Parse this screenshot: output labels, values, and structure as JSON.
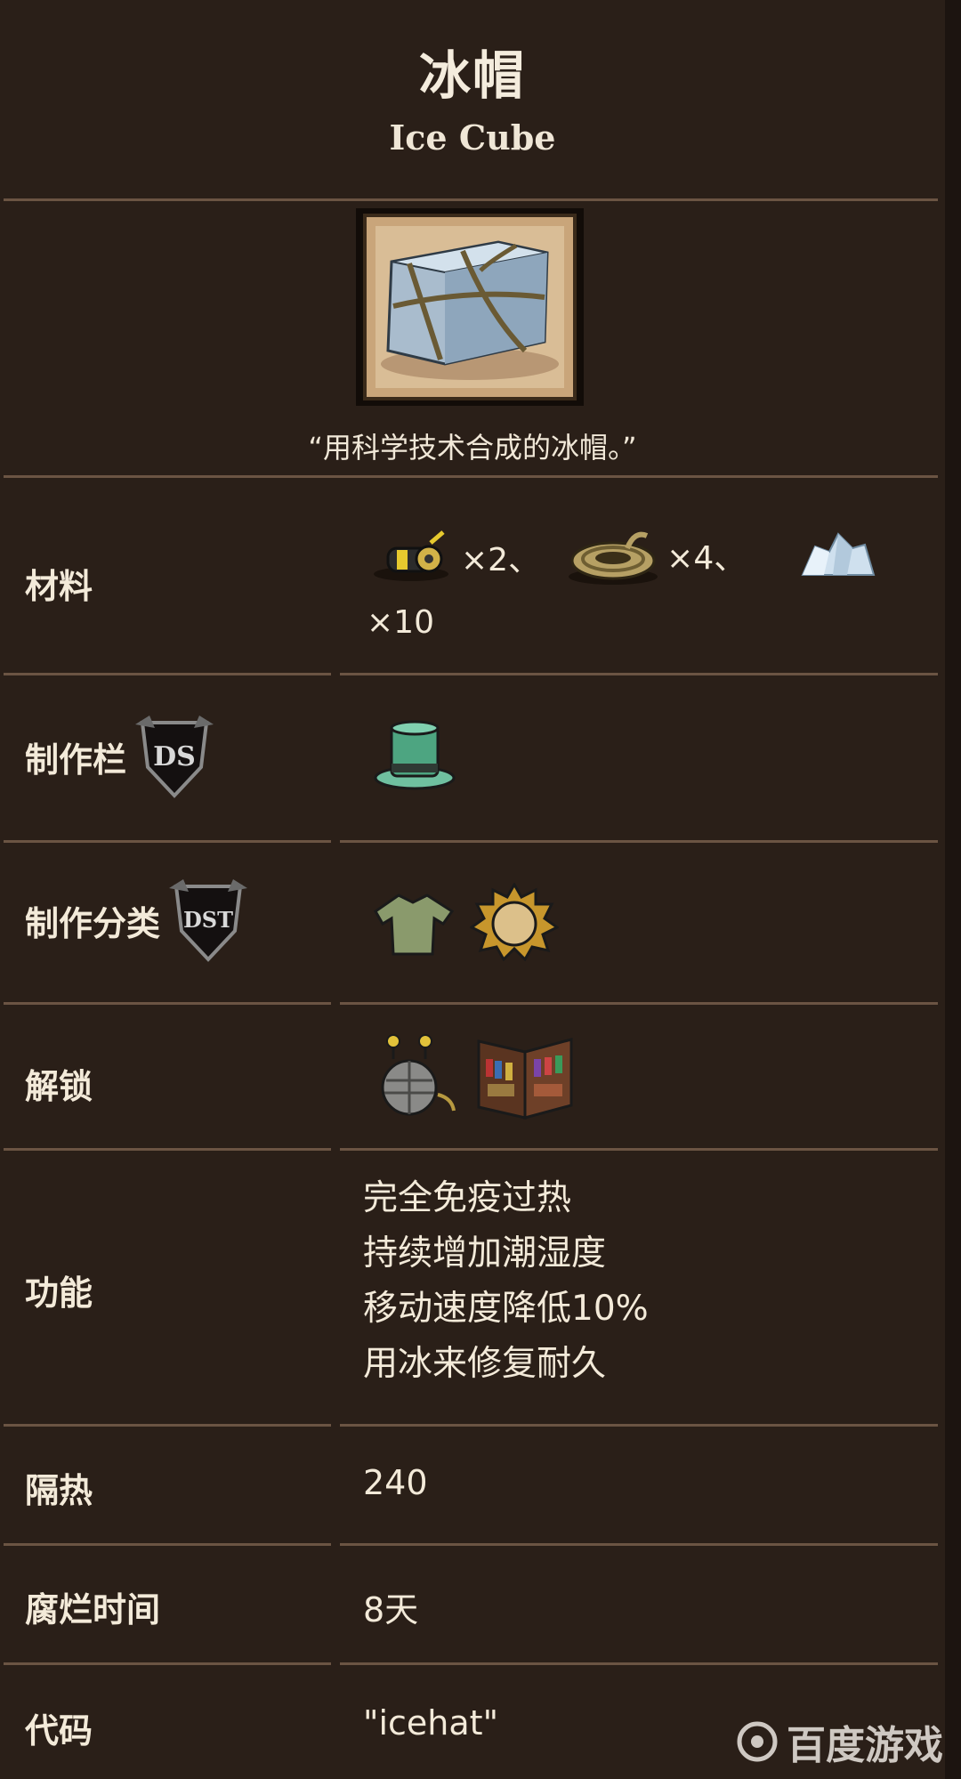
{
  "header": {
    "title": "冰帽",
    "subtitle": "Ice Cube"
  },
  "item": {
    "quote": "“用科学技术合成的冰帽。”"
  },
  "rows": {
    "materials": {
      "label": "材料",
      "items": [
        {
          "icon": "gears-icon",
          "count": "×2、"
        },
        {
          "icon": "rope-icon",
          "count": "×4、"
        },
        {
          "icon": "ice-icon",
          "count": "×10"
        }
      ]
    },
    "craft_tab": {
      "label": "制作栏",
      "badge": "DS",
      "icon": "top-hat-icon"
    },
    "craft_category": {
      "label": "制作分类",
      "badge": "DST",
      "icons": [
        "clothing-icon",
        "summer-icon"
      ]
    },
    "unlock": {
      "label": "解锁",
      "icons": [
        "science-machine-icon",
        "bookcase-icon"
      ]
    },
    "function": {
      "label": "功能",
      "lines": [
        "完全免疫过热",
        "持续增加潮湿度",
        "移动速度降低10%",
        "用冰来修复耐久"
      ]
    },
    "insulation": {
      "label": "隔热",
      "value": "240"
    },
    "spoil_time": {
      "label": "腐烂时间",
      "value": "8天"
    },
    "code": {
      "label": "代码",
      "value": "\"icehat\""
    }
  },
  "watermark": {
    "text": "百度游戏"
  },
  "colors": {
    "background": "#2a1f18",
    "divider": "#6b5443",
    "text": "#f3ead9"
  }
}
